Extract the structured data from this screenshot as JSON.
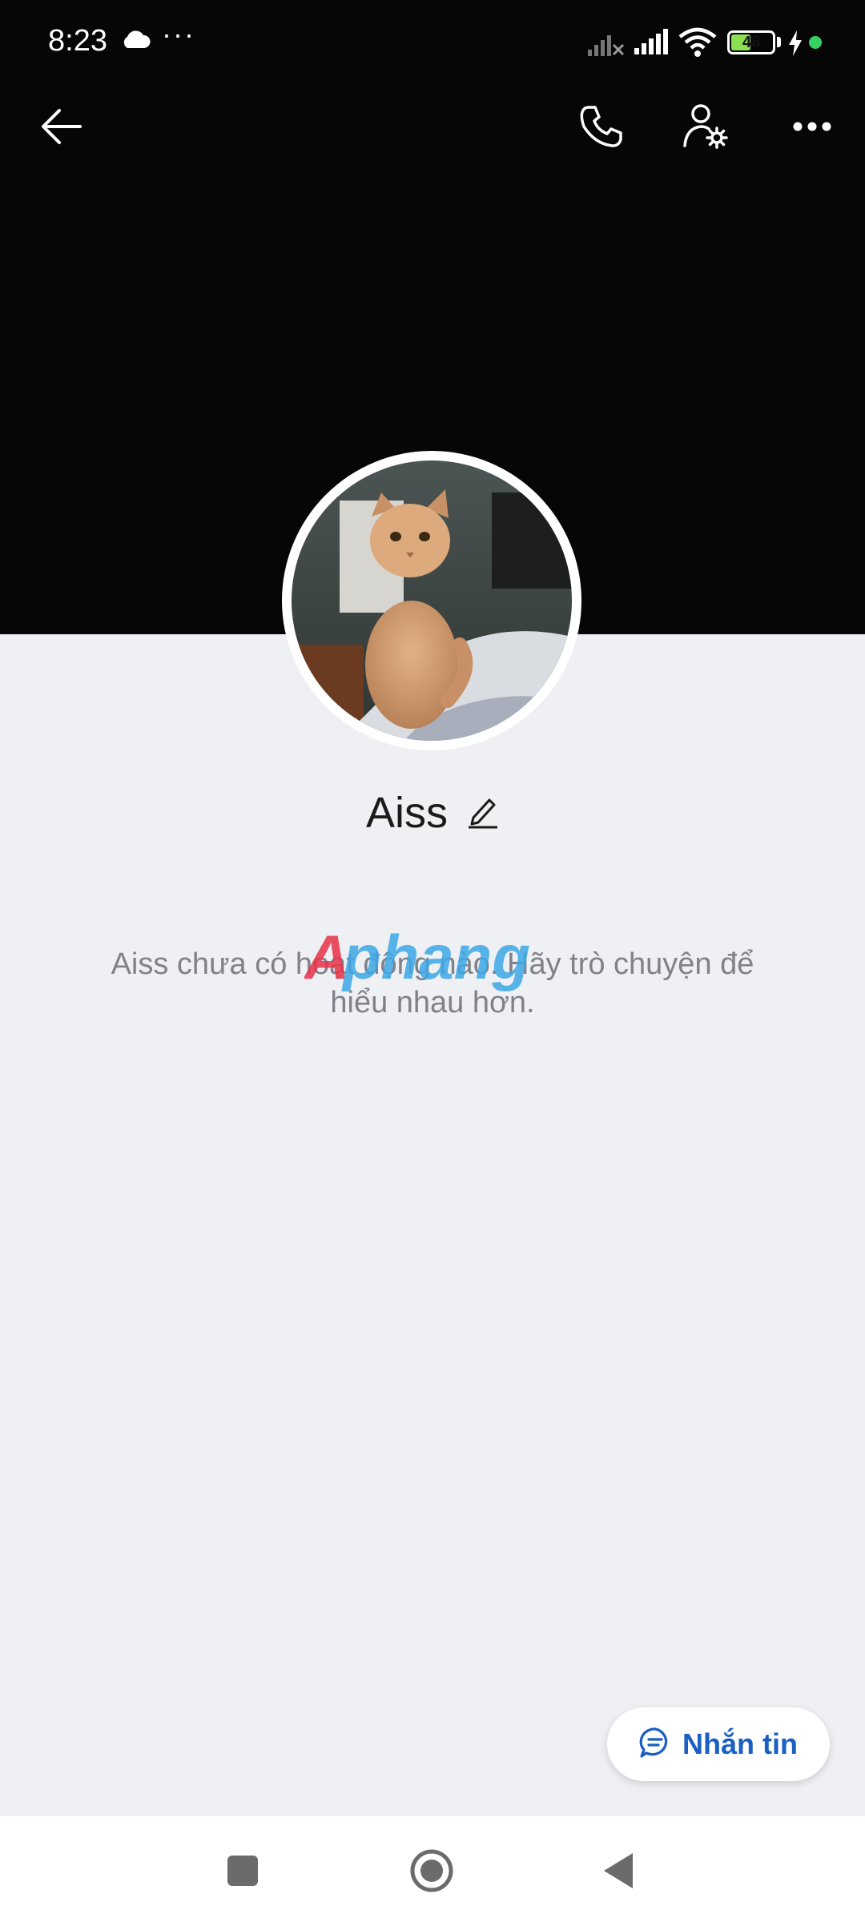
{
  "status_bar": {
    "time": "8:23",
    "dots": "···",
    "battery_level": "48",
    "battery_fraction": 0.48,
    "cloud_icon": "cloud-icon",
    "signal_icons": [
      "signal-off-icon",
      "signal-icon",
      "wifi-icon"
    ]
  },
  "toolbar": {
    "back_icon": "arrow-left-icon",
    "call_icon": "phone-icon",
    "settings_icon": "user-settings-icon",
    "more_icon": "more-horizontal-icon"
  },
  "profile": {
    "name": "Aiss",
    "edit_icon": "pencil-icon",
    "empty_message": "Aiss chưa có hoạt động nào. Hãy trò chuyện để hiểu nhau hơn."
  },
  "watermark": "Aphang",
  "message_button": {
    "label": "Nhắn tin",
    "icon": "chat-bubble-icon"
  },
  "nav": {
    "recents_icon": "square-icon",
    "home_icon": "circle-home-icon",
    "back_icon": "triangle-back-icon"
  },
  "colors": {
    "accent": "#1a5fc4",
    "cover": "#060606",
    "background": "#eff0f4",
    "battery_fill": "#8ce050"
  }
}
